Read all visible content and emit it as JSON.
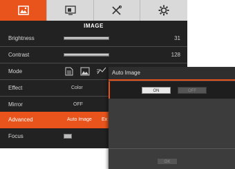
{
  "tabs": [
    {
      "icon": "image-settings-icon",
      "active": true
    },
    {
      "icon": "display-icon",
      "active": false
    },
    {
      "icon": "tools-icon",
      "active": false
    },
    {
      "icon": "settings-gear-icon",
      "active": false
    }
  ],
  "section_title": "IMAGE",
  "menu": {
    "brightness": {
      "label": "Brightness",
      "value": "31"
    },
    "contrast": {
      "label": "Contrast",
      "value": "128"
    },
    "mode": {
      "label": "Mode",
      "icons": [
        "document-mode-icon",
        "photo-mode-icon",
        "motion-mode-icon"
      ]
    },
    "effect": {
      "label": "Effect",
      "value": "Color"
    },
    "mirror": {
      "label": "Mirror",
      "value": "OFF"
    },
    "advanced": {
      "label": "Advanced",
      "value": "Auto Image",
      "truncated_next": "Ex"
    },
    "focus": {
      "label": "Focus"
    }
  },
  "dialog": {
    "title": "Auto Image",
    "on_label": "ON",
    "off_label": "OFF",
    "ok_label": "OK"
  },
  "colors": {
    "accent": "#e8541b",
    "panel": "#222222",
    "tab_bar": "#d9d9d9",
    "dialog": "#3c3c3c"
  }
}
